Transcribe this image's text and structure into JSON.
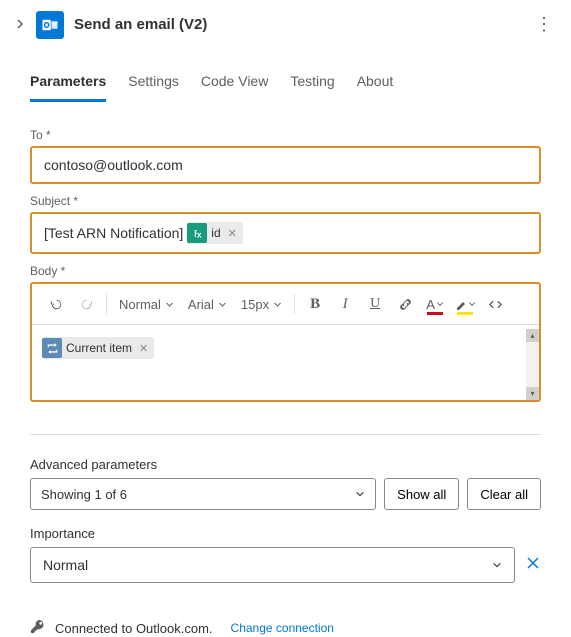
{
  "header": {
    "title": "Send an email (V2)"
  },
  "tabs": {
    "parameters": "Parameters",
    "settings": "Settings",
    "codeview": "Code View",
    "testing": "Testing",
    "about": "About"
  },
  "fields": {
    "to_label": "To *",
    "to_value": "contoso@outlook.com",
    "subject_label": "Subject *",
    "subject_prefix": "[Test ARN Notification]",
    "subject_token": "id",
    "body_label": "Body *",
    "body_token": "Current item"
  },
  "toolbar": {
    "style": "Normal",
    "font": "Arial",
    "size": "15px"
  },
  "advanced": {
    "label": "Advanced parameters",
    "summary": "Showing 1 of 6",
    "showall": "Show all",
    "clearall": "Clear all"
  },
  "importance": {
    "label": "Importance",
    "value": "Normal"
  },
  "connection": {
    "status": "Connected to Outlook.com.",
    "change": "Change connection"
  }
}
